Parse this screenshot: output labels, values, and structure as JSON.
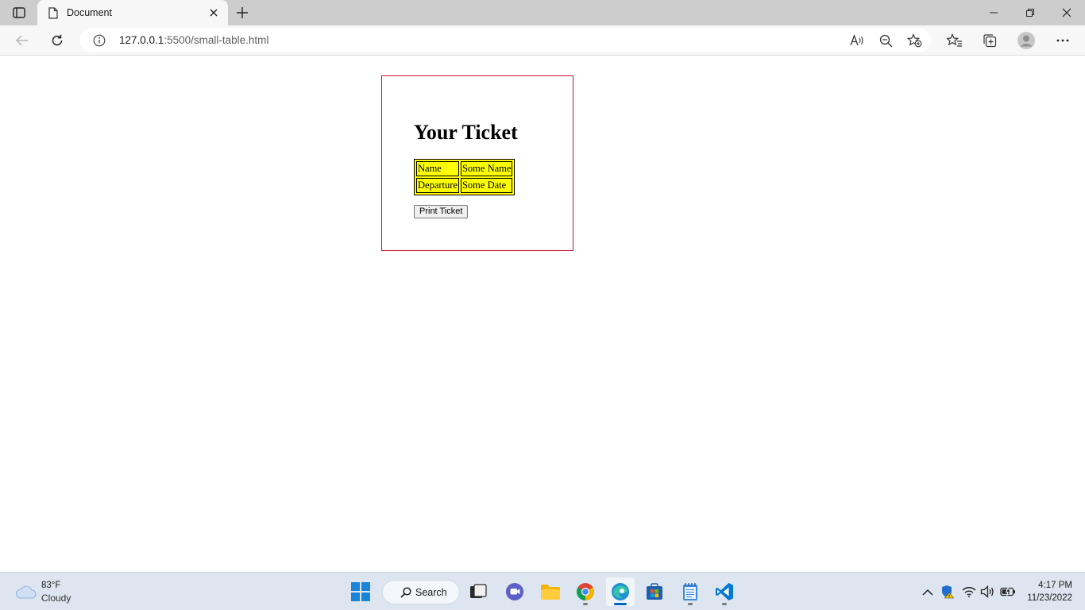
{
  "browser": {
    "tab": {
      "title": "Document"
    },
    "address": {
      "host": "127.0.0.1",
      "path": ":5500/small-table.html"
    }
  },
  "page": {
    "heading": "Your Ticket",
    "table": {
      "rows": [
        {
          "label": "Name",
          "value": "Some Name"
        },
        {
          "label": "Departure",
          "value": "Some Date"
        }
      ]
    },
    "print_button": "Print Ticket",
    "colors": {
      "box_border": "#c8102e",
      "table_bg": "#ffff00"
    }
  },
  "taskbar": {
    "weather": {
      "temp": "83°F",
      "condition": "Cloudy"
    },
    "search_label": "Search",
    "clock": {
      "time": "4:17 PM",
      "date": "11/23/2022"
    }
  }
}
